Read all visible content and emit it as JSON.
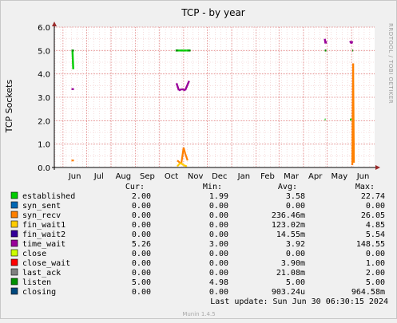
{
  "chart_data": {
    "type": "line",
    "title": "TCP - by year",
    "ylabel": "TCP Sockets",
    "xlabel": "",
    "ylim": [
      0,
      6
    ],
    "yticks": [
      "0.0",
      "1.0",
      "2.0",
      "3.0",
      "4.0",
      "5.0",
      "6.0"
    ],
    "x_tick_labels": [
      "Jun",
      "Jul",
      "Aug",
      "Sep",
      "Oct",
      "Nov",
      "Dec",
      "Jan",
      "Feb",
      "Mar",
      "Apr",
      "May",
      "Jun"
    ],
    "side_label": "RRDTOOL / TOBI OETIKER",
    "grid": true,
    "series": [
      {
        "name": "established",
        "color": "#00cc00",
        "points": [
          [
            "2023-06-13",
            5.0
          ],
          [
            "2023-06-14",
            4.2
          ],
          [
            "2023-10-23",
            5.0
          ],
          [
            "2023-10-24",
            5.0
          ],
          [
            "2023-10-27",
            5.0
          ],
          [
            "2023-11-01",
            5.0
          ],
          [
            "2023-11-05",
            5.0
          ],
          [
            "2023-11-08",
            5.0
          ],
          [
            "2024-04-28",
            2.05
          ],
          [
            "2024-04-29",
            2.05
          ],
          [
            "2024-05-30",
            2.05
          ],
          [
            "2024-06-01",
            2.05
          ]
        ]
      },
      {
        "name": "syn_sent",
        "color": "#0066b3",
        "points": []
      },
      {
        "name": "syn_recv",
        "color": "#ff8000",
        "points": [
          [
            "2023-06-13",
            0.3
          ],
          [
            "2023-10-24",
            0.3
          ],
          [
            "2023-10-29",
            0.15
          ],
          [
            "2023-11-01",
            0.85
          ],
          [
            "2023-11-03",
            0.6
          ],
          [
            "2023-11-06",
            0.3
          ],
          [
            "2024-06-02",
            0.1
          ],
          [
            "2024-06-03",
            4.45
          ],
          [
            "2024-06-04",
            0.2
          ]
        ]
      },
      {
        "name": "fin_wait1",
        "color": "#ffcc00",
        "points": [
          [
            "2023-10-24",
            0.05
          ],
          [
            "2023-10-28",
            0.2
          ],
          [
            "2023-11-01",
            0.1
          ],
          [
            "2023-11-05",
            0.05
          ]
        ]
      },
      {
        "name": "fin_wait2",
        "color": "#330099",
        "points": []
      },
      {
        "name": "time_wait",
        "color": "#990099",
        "points": [
          [
            "2023-06-13",
            3.35
          ],
          [
            "2023-10-23",
            3.6
          ],
          [
            "2023-10-26",
            3.3
          ],
          [
            "2023-10-30",
            3.35
          ],
          [
            "2023-11-03",
            3.3
          ],
          [
            "2023-11-08",
            3.7
          ],
          [
            "2024-04-28",
            5.5
          ],
          [
            "2024-04-29",
            5.3
          ],
          [
            "2024-04-30",
            5.4
          ],
          [
            "2024-05-30",
            5.4
          ],
          [
            "2024-06-01",
            5.3
          ],
          [
            "2024-06-02",
            5.4
          ]
        ]
      },
      {
        "name": "close",
        "color": "#ccff00",
        "points": []
      },
      {
        "name": "close_wait",
        "color": "#ff0000",
        "points": []
      },
      {
        "name": "last_ack",
        "color": "#808080",
        "points": []
      },
      {
        "name": "listen",
        "color": "#008f00",
        "points": [
          [
            "2023-06-13",
            5.0
          ],
          [
            "2023-10-23",
            5.0
          ],
          [
            "2023-11-08",
            5.0
          ],
          [
            "2024-04-28",
            5.0
          ],
          [
            "2024-04-30",
            5.0
          ],
          [
            "2024-06-02",
            5.0
          ],
          [
            "2024-06-03",
            5.0
          ]
        ]
      },
      {
        "name": "closing",
        "color": "#00487d",
        "points": []
      }
    ]
  },
  "legend": {
    "headers": {
      "cur": "Cur:",
      "min": "Min:",
      "avg": "Avg:",
      "max": "Max:"
    },
    "rows": [
      {
        "name": "established",
        "color": "#00cc00",
        "cur": "2.00",
        "min": "1.99",
        "avg": "3.58",
        "max": "22.74"
      },
      {
        "name": "syn_sent",
        "color": "#0066b3",
        "cur": "0.00",
        "min": "0.00",
        "avg": "0.00",
        "max": "0.00"
      },
      {
        "name": "syn_recv",
        "color": "#ff8000",
        "cur": "0.00",
        "min": "0.00",
        "avg": "236.46m",
        "max": "26.05"
      },
      {
        "name": "fin_wait1",
        "color": "#ffcc00",
        "cur": "0.00",
        "min": "0.00",
        "avg": "123.02m",
        "max": "4.85"
      },
      {
        "name": "fin_wait2",
        "color": "#330099",
        "cur": "0.00",
        "min": "0.00",
        "avg": "14.55m",
        "max": "5.54"
      },
      {
        "name": "time_wait",
        "color": "#990099",
        "cur": "5.26",
        "min": "3.00",
        "avg": "3.92",
        "max": "148.55"
      },
      {
        "name": "close",
        "color": "#ccff00",
        "cur": "0.00",
        "min": "0.00",
        "avg": "0.00",
        "max": "0.00"
      },
      {
        "name": "close_wait",
        "color": "#ff0000",
        "cur": "0.00",
        "min": "0.00",
        "avg": "3.90m",
        "max": "1.00"
      },
      {
        "name": "last_ack",
        "color": "#808080",
        "cur": "0.00",
        "min": "0.00",
        "avg": "21.08m",
        "max": "2.00"
      },
      {
        "name": "listen",
        "color": "#008f00",
        "cur": "5.00",
        "min": "4.98",
        "avg": "5.00",
        "max": "5.00"
      },
      {
        "name": "closing",
        "color": "#00487d",
        "cur": "0.00",
        "min": "0.00",
        "avg": "903.24u",
        "max": "964.58m"
      }
    ]
  },
  "last_update": "Last update:  Sun Jun 30 06:30:15 2024",
  "footer": "Munin 1.4.5"
}
